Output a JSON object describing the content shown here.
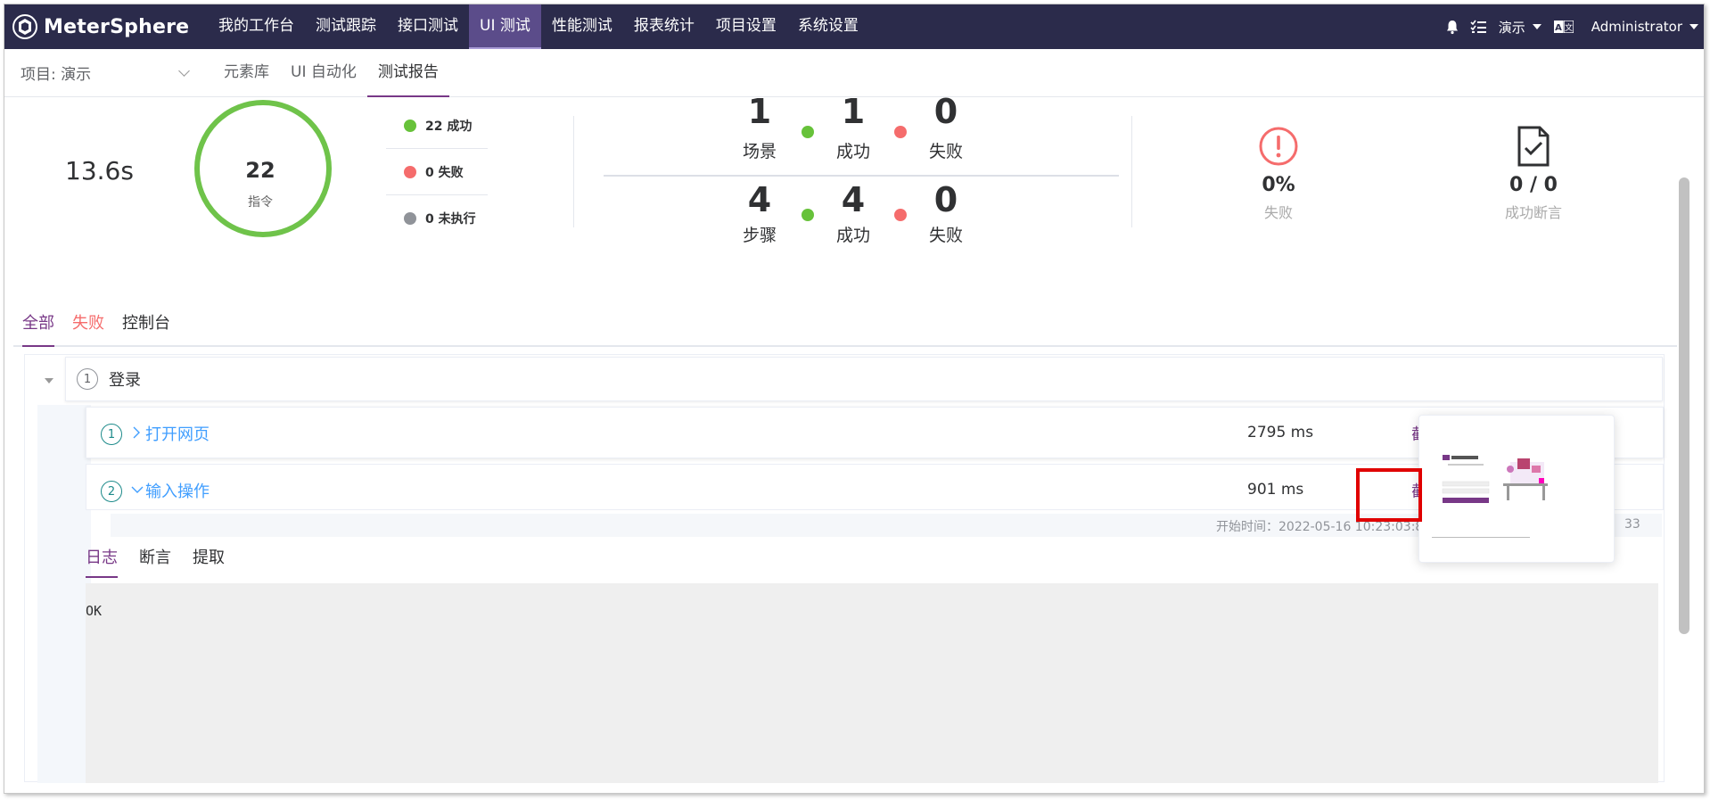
{
  "app": {
    "brand": "MeterSphere"
  },
  "topnav": {
    "menu": [
      "我的工作台",
      "测试跟踪",
      "接口测试",
      "UI 测试",
      "性能测试",
      "报表统计",
      "项目设置",
      "系统设置"
    ],
    "active_index": 3,
    "project": "演示",
    "user": "Administrator",
    "icons": [
      "bell-icon",
      "task-list-icon",
      "language-icon"
    ]
  },
  "subnav": {
    "project_label": "项目: 演示",
    "tabs": [
      "元素库",
      "UI 自动化",
      "测试报告"
    ],
    "active_tab": "测试报告"
  },
  "summary": {
    "duration": "13.6s",
    "total_commands": "22",
    "total_label": "指令",
    "legend": [
      {
        "text": "22 成功",
        "color": "#67c23a"
      },
      {
        "text": "0 失败",
        "color": "#f56c6c"
      },
      {
        "text": "0 未执行",
        "color": "#909399"
      }
    ],
    "scenario": {
      "count": "1",
      "count_label": "场景",
      "success": "1",
      "success_label": "成功",
      "fail": "0",
      "fail_label": "失败"
    },
    "step": {
      "count": "4",
      "count_label": "步骤",
      "success": "4",
      "success_label": "成功",
      "fail": "0",
      "fail_label": "失败"
    },
    "fail_rate": {
      "value": "0%",
      "label": "失败"
    },
    "assertion": {
      "value": "0 / 0",
      "label": "成功断言"
    }
  },
  "result_tabs": [
    "全部",
    "失败",
    "控制台"
  ],
  "scenario_row": {
    "index": "1",
    "name": "登录"
  },
  "steps": [
    {
      "index": "1",
      "name": "打开网页",
      "time": "2795 ms",
      "screenshot": "截图"
    },
    {
      "index": "2",
      "name": "输入操作",
      "time": "901 ms",
      "screenshot": "截图"
    }
  ],
  "step_detail": {
    "time_text": "开始时间：2022-05-16 10:23:03:82 结",
    "time_suffix": "33",
    "tabs": [
      "日志",
      "断言",
      "提取"
    ],
    "log": "OK"
  },
  "colors": {
    "brand_dark": "#2b2b4b",
    "accent": "#783887",
    "success": "#67c23a",
    "fail": "#f56c6c",
    "link": "#409eff"
  }
}
